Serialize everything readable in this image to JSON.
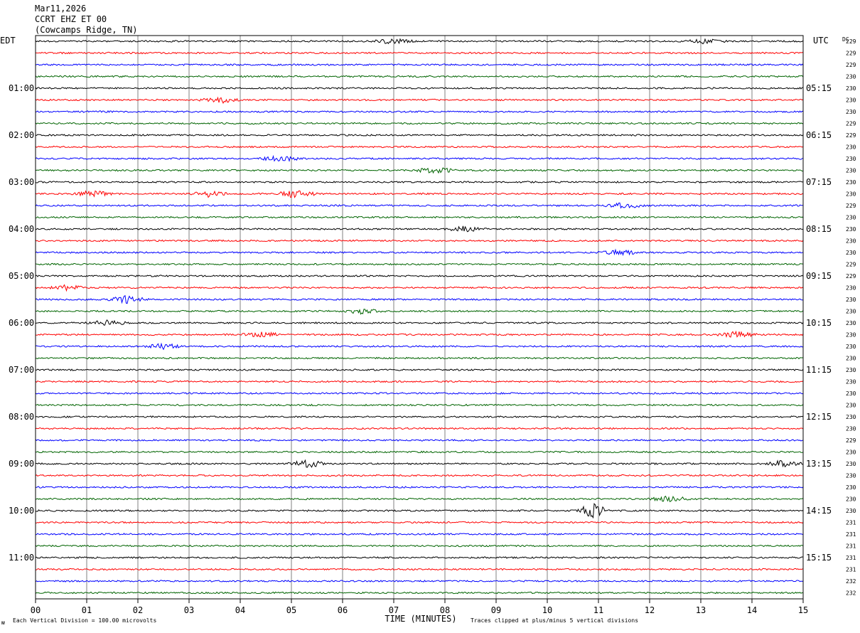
{
  "header": {
    "date": "Mar11,2026",
    "station": "CCRT EHZ ET 00",
    "location": "(Cowcamps Ridge, TN)"
  },
  "left_timezone": "EDT",
  "right_timezone": "UTC",
  "dc_label": "DC",
  "footer": {
    "scale_note": "Each Vertical Division =  100.00 microvolts",
    "clip_note": "Traces clipped at plus/minus 5 vertical divisions",
    "corner_mark": "ᴍ"
  },
  "colors": {
    "trace_cycle": [
      "#000000",
      "#ff0000",
      "#0000ff",
      "#006400"
    ],
    "grid": "#808080",
    "frame": "#000000"
  },
  "chart_data": {
    "type": "line",
    "title": "CCRT EHZ ET 00",
    "xlabel": "TIME (MINUTES)",
    "ylabel": "",
    "xlim": [
      0,
      15
    ],
    "x_ticks": [
      "00",
      "01",
      "02",
      "03",
      "04",
      "05",
      "06",
      "07",
      "08",
      "09",
      "10",
      "11",
      "12",
      "13",
      "14",
      "15"
    ],
    "trace_count": 48,
    "traces_per_hour": 4,
    "left_hour_labels": [
      "01:00",
      "02:00",
      "03:00",
      "04:00",
      "05:00",
      "06:00",
      "07:00",
      "08:00",
      "09:00",
      "10:00",
      "11:00"
    ],
    "right_hour_labels": [
      "05:15",
      "06:15",
      "07:15",
      "08:15",
      "09:15",
      "10:15",
      "11:15",
      "12:15",
      "13:15",
      "14:15",
      "15:15"
    ],
    "dc_offsets": [
      229,
      229,
      229,
      230,
      230,
      230,
      230,
      229,
      229,
      230,
      230,
      230,
      230,
      230,
      229,
      230,
      230,
      230,
      230,
      229,
      229,
      230,
      230,
      230,
      230,
      230,
      230,
      230,
      230,
      230,
      230,
      230,
      230,
      230,
      229,
      230,
      230,
      230,
      230,
      230,
      230,
      231,
      231,
      231,
      231,
      231,
      232,
      232
    ],
    "bursts": [
      {
        "trace": 0,
        "minute": 7.0,
        "amp": 1.6
      },
      {
        "trace": 0,
        "minute": 13.1,
        "amp": 1.4
      },
      {
        "trace": 5,
        "minute": 3.6,
        "amp": 1.8
      },
      {
        "trace": 10,
        "minute": 4.8,
        "amp": 1.8
      },
      {
        "trace": 11,
        "minute": 7.8,
        "amp": 1.9
      },
      {
        "trace": 13,
        "minute": 1.1,
        "amp": 1.8
      },
      {
        "trace": 13,
        "minute": 3.4,
        "amp": 1.9
      },
      {
        "trace": 13,
        "minute": 5.1,
        "amp": 2.4
      },
      {
        "trace": 14,
        "minute": 11.5,
        "amp": 1.7
      },
      {
        "trace": 16,
        "minute": 8.4,
        "amp": 1.6
      },
      {
        "trace": 18,
        "minute": 11.4,
        "amp": 1.6
      },
      {
        "trace": 21,
        "minute": 0.6,
        "amp": 1.5
      },
      {
        "trace": 22,
        "minute": 1.8,
        "amp": 2.2
      },
      {
        "trace": 23,
        "minute": 6.4,
        "amp": 1.8
      },
      {
        "trace": 24,
        "minute": 1.4,
        "amp": 1.5
      },
      {
        "trace": 25,
        "minute": 4.4,
        "amp": 1.7
      },
      {
        "trace": 25,
        "minute": 13.7,
        "amp": 1.8
      },
      {
        "trace": 26,
        "minute": 2.5,
        "amp": 1.6
      },
      {
        "trace": 36,
        "minute": 5.3,
        "amp": 2.2
      },
      {
        "trace": 36,
        "minute": 14.6,
        "amp": 2.0
      },
      {
        "trace": 39,
        "minute": 12.4,
        "amp": 1.6
      },
      {
        "trace": 40,
        "minute": 10.9,
        "amp": 5.0
      }
    ]
  }
}
